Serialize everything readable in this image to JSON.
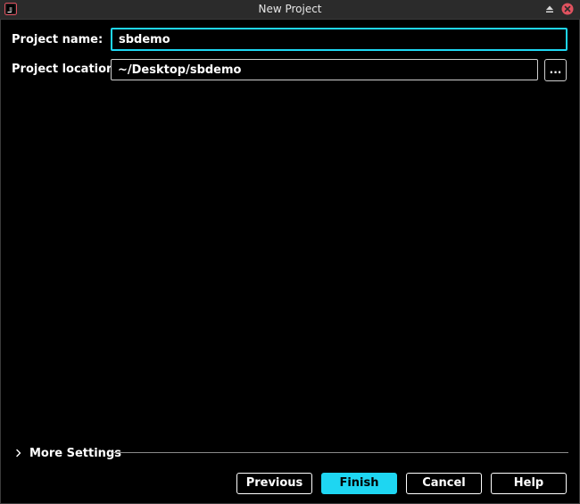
{
  "window": {
    "title": "New Project",
    "accent": "#1ed6f2",
    "close_color": "#e0525f"
  },
  "form": {
    "name_label": "Project name:",
    "name_value": "sbdemo",
    "location_label": "Project location:",
    "location_value": "~/Desktop/sbdemo",
    "browse_label": "..."
  },
  "more_settings": {
    "label": "More Settings",
    "expanded": false
  },
  "buttons": {
    "previous": "Previous",
    "finish": "Finish",
    "cancel": "Cancel",
    "help": "Help"
  }
}
